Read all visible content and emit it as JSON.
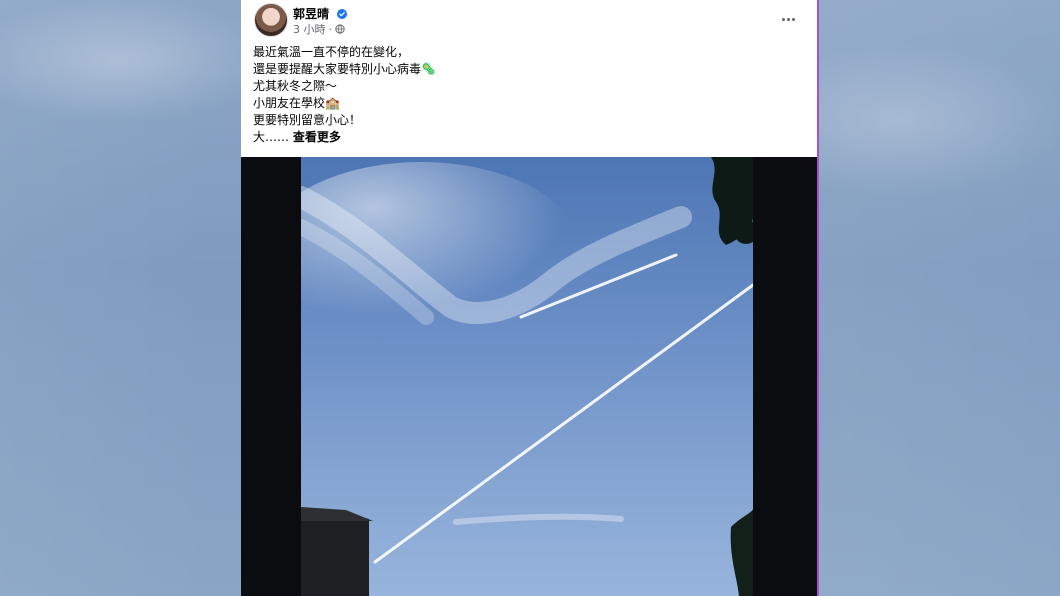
{
  "post": {
    "author": "郭昱晴",
    "time": "3 小時",
    "separator": "·",
    "lines": [
      "最近氣溫一直不停的在變化，",
      "還是要提醒大家要特別小心病毒🦠",
      "尤其秋冬之際～",
      "小朋友在學校🏫",
      "更要特別留意小心！"
    ],
    "truncated_prefix": "大……",
    "see_more": "查看更多"
  },
  "icons": {
    "verified": "verified-badge-icon",
    "privacy": "globe-icon",
    "more": "more-options-icon"
  },
  "colors": {
    "accent": "#1877f2",
    "meta": "#65676b",
    "text": "#050505"
  }
}
